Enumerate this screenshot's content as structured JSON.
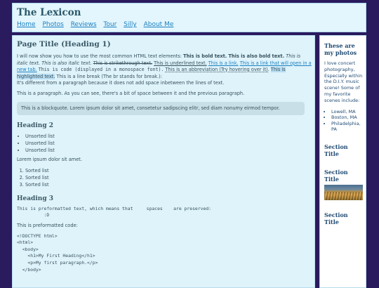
{
  "site": {
    "title": "The Lexicon",
    "nav": [
      "Home",
      "Photos",
      "Reviews",
      "Tour",
      "Silly",
      "About Me"
    ]
  },
  "main": {
    "page_title": "Page Title (Heading 1)",
    "intro_text": "I will now show you how to use the most common HTML text elements: ",
    "bold_1": "This is bold text.",
    "bold_2": "This is also bold text.",
    "italic_1": "This is italic text.",
    "italic_2": "This is also italic text.",
    "strike": "This is strikethrough text.",
    "underline": "This is underlined text.",
    "link_1": "This is a link.",
    "link_2": "This is a link that will open in a new tab.",
    "code": "This is code (displayed in a monospace font).",
    "abbr": "This is an abbreviation (Try hovering over it).",
    "highlight": "This is highlighted text.",
    "line_break_1": "This is a line break (The br stands for break.):",
    "line_break_2": "It's different from a paragraph because it does not add space inbetween the lines of text.",
    "paragraph": "This is a paragraph. As you can see, there's a bit of space between it and the previous paragraph.",
    "blockquote": "This is a blockquote. Lorem ipsum dolor sit amet, consetetur sadipscing elitr, sed diam nonumy eirmod tempor.",
    "heading_2": "Heading 2",
    "unsorted": [
      "Unsorted list",
      "Unsorted list",
      "Unsorted list"
    ],
    "lorem": "Lorem ipsum dolor sit amet.",
    "sorted": [
      "Sorted list",
      "Sorted list",
      "Sorted list"
    ],
    "heading_3": "Heading 3",
    "pre_1": "This is preformatted text, which means that     spaces    are preserved:\n          :D",
    "pre_label": "This is preformatted code:",
    "pre_code": "<!DOCTYPE html>\n<html>\n  <body>\n    <h1>My First Heading</h1>\n    <p>My first paragraph.</p>\n  </body>"
  },
  "sidebar": {
    "title": "These are my photos",
    "text": "I love concert photography, Especially within the D.I.Y. music scene! Some of my favorite scenes include:",
    "places": [
      "Lowell, MA",
      "Boston, MA",
      "Philadelphia, PA"
    ],
    "section_1": "Section Title",
    "section_2": "Section Title",
    "section_3": "Section Title"
  }
}
